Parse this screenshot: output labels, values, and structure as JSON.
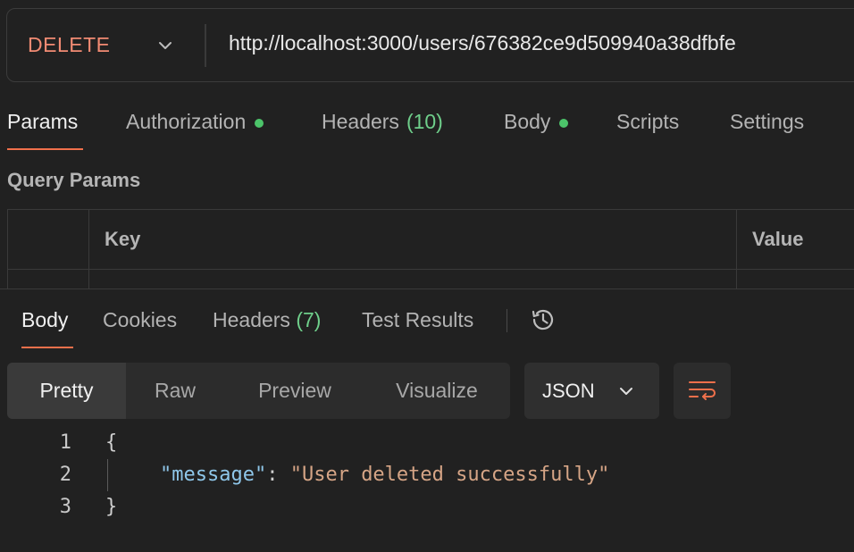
{
  "request": {
    "method": "DELETE",
    "url": "http://localhost:3000/users/676382ce9d509940a38dfbfe"
  },
  "request_tabs": [
    {
      "label": "Params",
      "active": true
    },
    {
      "label": "Authorization",
      "dot": true
    },
    {
      "label": "Headers",
      "count": "(10)"
    },
    {
      "label": "Body",
      "dot": true
    },
    {
      "label": "Scripts"
    },
    {
      "label": "Settings"
    }
  ],
  "query_params": {
    "title": "Query Params",
    "col_key": "Key",
    "col_value": "Value"
  },
  "response_tabs": [
    {
      "label": "Body",
      "active": true
    },
    {
      "label": "Cookies"
    },
    {
      "label": "Headers",
      "count": "(7)"
    },
    {
      "label": "Test Results"
    }
  ],
  "view_modes": [
    "Pretty",
    "Raw",
    "Preview",
    "Visualize"
  ],
  "format": "JSON",
  "code": {
    "line_numbers": [
      "1",
      "2",
      "3"
    ],
    "open_brace": "{",
    "key": "\"message\"",
    "colon": ": ",
    "value": "\"User deleted successfully\"",
    "close_brace": "}"
  },
  "colors": {
    "method": "#f28b73",
    "accent": "#f0704b",
    "count": "#6fcf8b",
    "dot": "#4cc46a"
  },
  "icons": {
    "method_chevron": "chevron-down-icon",
    "history": "history-icon",
    "format_chevron": "chevron-down-icon",
    "wrap": "wrap-lines-icon"
  }
}
